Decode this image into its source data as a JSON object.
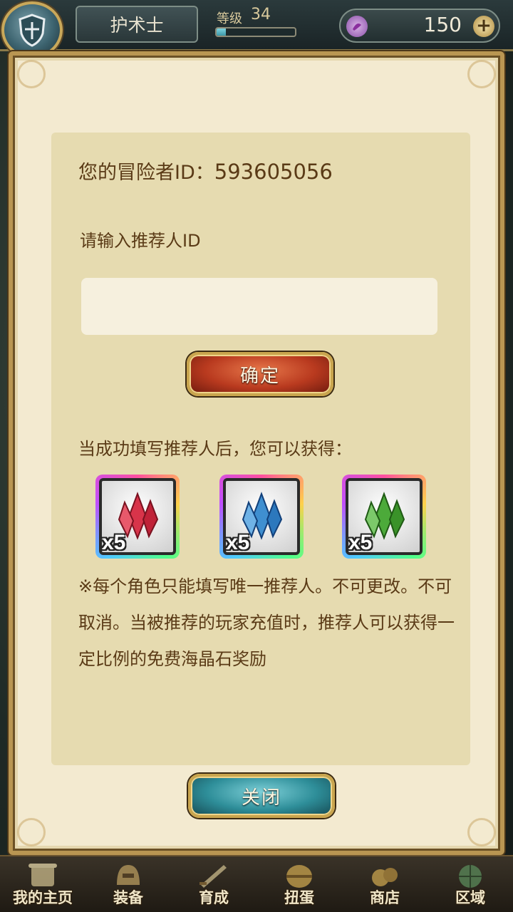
{
  "header": {
    "character_name": "护术士",
    "level_label": "等级",
    "level_value": "34",
    "level_progress": 0.12,
    "currency_value": "150",
    "currency_add_label": "+"
  },
  "dialog": {
    "adventurer_id_label": "您的冒险者ID：",
    "adventurer_id_value": "593605056",
    "referrer_prompt": "请输入推荐人ID",
    "referrer_input_value": "",
    "confirm_label": "确定",
    "reward_title": "当成功填写推荐人后，您可以获得：",
    "rewards": [
      {
        "name": "red-crystal",
        "count": "x5",
        "color": "#d8344a"
      },
      {
        "name": "blue-crystal",
        "count": "x5",
        "color": "#3f8fd0"
      },
      {
        "name": "green-crystal",
        "count": "x5",
        "color": "#4caa3a"
      }
    ],
    "note": "※每个角色只能填写唯一推荐人。不可更改。不可取消。当被推荐的玩家充值时，推荐人可以获得一定比例的免费海晶石奖励",
    "close_label": "关闭"
  },
  "bottom_nav": [
    {
      "label": "我的主页",
      "icon": "scroll-icon"
    },
    {
      "label": "装备",
      "icon": "helmet-icon"
    },
    {
      "label": "育成",
      "icon": "sword-icon"
    },
    {
      "label": "扭蛋",
      "icon": "capsule-icon"
    },
    {
      "label": "商店",
      "icon": "shop-icon"
    },
    {
      "label": "区域",
      "icon": "globe-icon"
    }
  ]
}
